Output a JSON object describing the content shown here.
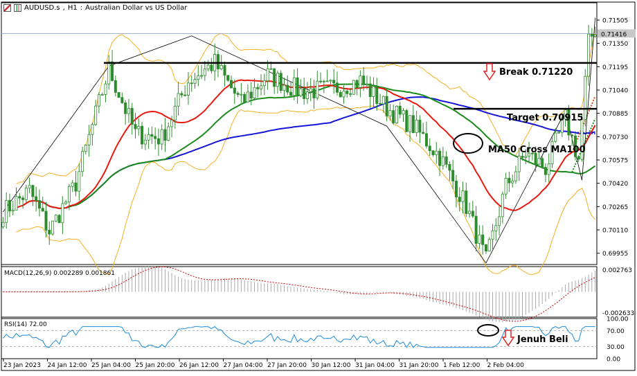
{
  "header": {
    "symbol": "AUDUSD.s",
    "timeframe": "H1",
    "description": "Australian Dollar vs US Dollar"
  },
  "chart_data": [
    {
      "type": "candlestick",
      "ylim": [
        0.6988,
        0.7162
      ],
      "yticks": [
        "0.71505",
        "0.71350",
        "0.71195",
        "0.71040",
        "0.70885",
        "0.70730",
        "0.70575",
        "0.70420",
        "0.70265",
        "0.70110",
        "0.69955"
      ],
      "current_price": "0.71416",
      "series": [
        {
          "name": "MA 20",
          "color": "#e8190e"
        },
        {
          "name": "MA50",
          "color": "#1a8a1a"
        },
        {
          "name": "MA100",
          "color": "#1515d8"
        },
        {
          "name": "Bollinger Bands",
          "color": "#f5b021"
        }
      ],
      "levels": [
        {
          "label": "Break 0.71220",
          "value": 0.7122
        },
        {
          "label": "Target 0.70915",
          "value": 0.70915
        }
      ],
      "annotations": [
        "MA50 Cross MA100"
      ],
      "colors": {
        "candle": "#2e8b2e",
        "zigzag": "#000000",
        "current_line": "#9aaac8"
      }
    },
    {
      "type": "histogram",
      "title": "MACD(12,26,9) 0.002289 0.001861",
      "ylim": [
        -0.0029,
        0.0029
      ],
      "yticks": [
        "0.002763",
        "-0.002633"
      ],
      "colors": {
        "histogram": "#a9a9a9",
        "signal": "#cc0000"
      }
    },
    {
      "type": "line",
      "title": "RSI(14) 72.00",
      "ylim": [
        0,
        100
      ],
      "yticks": [
        "100.00",
        "70.00",
        "30.00",
        "0.00"
      ],
      "annotation": "Jenuh Beli",
      "colors": {
        "line": "#1e8ad8"
      }
    }
  ],
  "x_axis": {
    "labels": [
      "23 Jan 2023",
      "24 Jan 12:00",
      "25 Jan 04:00",
      "25 Jan 20:00",
      "26 Jan 12:00",
      "27 Jan 04:00",
      "27 Jan 20:00",
      "30 Jan 12:00",
      "31 Jan 04:00",
      "31 Jan 20:00",
      "1 Feb 12:00",
      "2 Feb 04:00"
    ]
  }
}
